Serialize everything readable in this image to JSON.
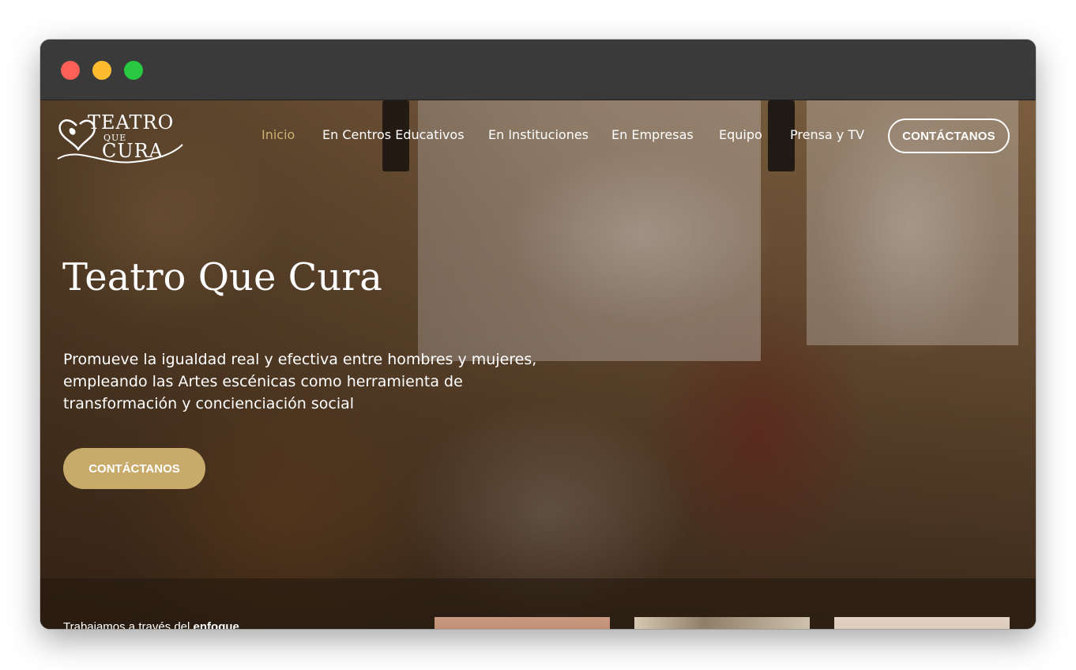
{
  "brand": {
    "logo_line1": "TEATRO",
    "logo_line2": "QUE",
    "logo_line3": "CURA"
  },
  "nav": {
    "items": [
      {
        "label": "Inicio",
        "active": true
      },
      {
        "label": "En Centros Educativos",
        "active": false
      },
      {
        "label": "En Instituciones",
        "active": false
      },
      {
        "label": "En Empresas",
        "active": false
      },
      {
        "label": "Equipo",
        "active": false
      },
      {
        "label": "Prensa y TV",
        "active": false
      }
    ],
    "cta_label": "CONTÁCTANOS"
  },
  "hero": {
    "title": "Teatro Que Cura",
    "description": "Promueve la igualdad real y efectiva entre hombres y mujeres, empleando las Artes escénicas como herramienta de transformación y concienciación social",
    "cta_label": "CONTÁCTANOS"
  },
  "section": {
    "intro_text": "Trabajamos a través del",
    "intro_bold": "enfoque"
  },
  "colors": {
    "accent_gold": "#c8ab6b",
    "active_nav": "#cdb072",
    "titlebar": "#3a3a3a"
  }
}
